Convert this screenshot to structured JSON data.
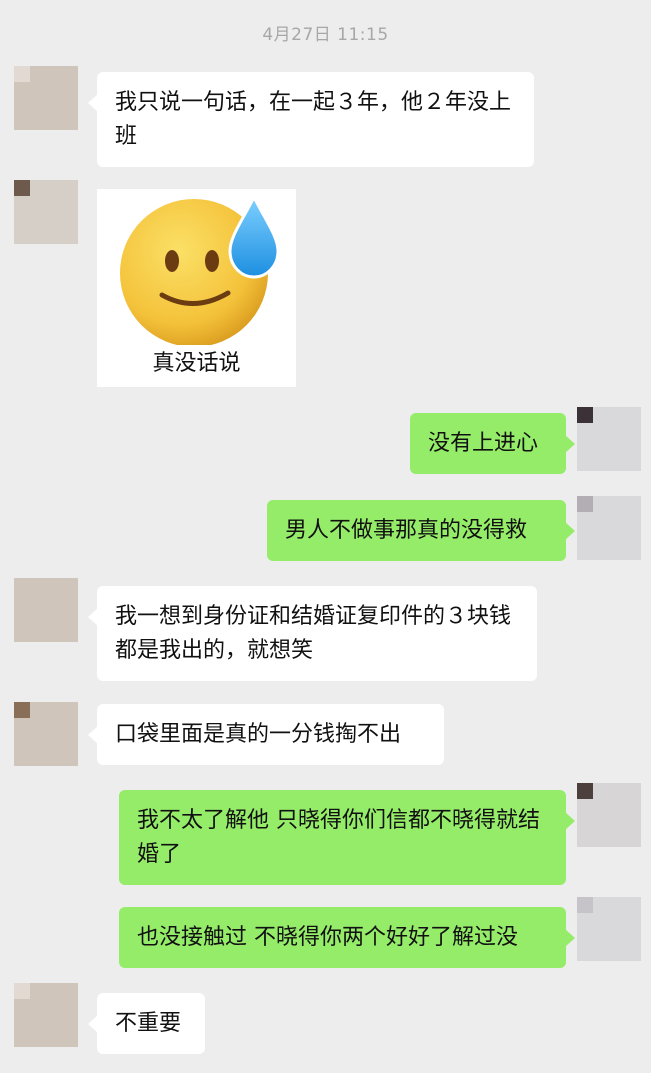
{
  "timestamp": "4月27日 11:15",
  "messages": [
    {
      "side": "left",
      "text": "我只说一句话，在一起３年，他２年没上班"
    },
    {
      "side": "left",
      "sticker": "sweat-smile-emoji",
      "caption": "真没话说"
    },
    {
      "side": "right",
      "text": "没有上进心"
    },
    {
      "side": "right",
      "text": "男人不做事那真的没得救"
    },
    {
      "side": "left",
      "text": "我一想到身份证和结婚证复印件的３块钱都是我出的，就想笑"
    },
    {
      "side": "left",
      "text": "口袋里面是真的一分钱掏不出"
    },
    {
      "side": "right",
      "text": "我不太了解他 只晓得你们信都不晓得就结婚了"
    },
    {
      "side": "right",
      "text": "也没接触过 不晓得你两个好好了解过没"
    },
    {
      "side": "left",
      "text": "不重要"
    }
  ],
  "colors": {
    "background": "#ededed",
    "left_bubble": "#ffffff",
    "right_bubble": "#95ec69"
  }
}
